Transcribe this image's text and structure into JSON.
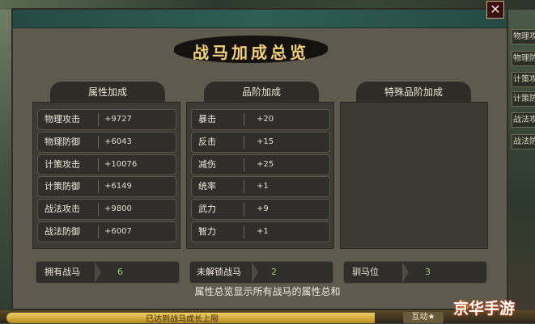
{
  "side_tabs": [
    "物理攻",
    "物理防",
    "计策攻",
    "计策防",
    "战法攻",
    "战法防"
  ],
  "panel": {
    "title": "战马加成总览",
    "close_label": "✕"
  },
  "sections": {
    "attribute": {
      "header": "属性加成",
      "rows": [
        {
          "label": "物理攻击",
          "value": "+9727"
        },
        {
          "label": "物理防御",
          "value": "+6043"
        },
        {
          "label": "计策攻击",
          "value": "+10076"
        },
        {
          "label": "计策防御",
          "value": "+6149"
        },
        {
          "label": "战法攻击",
          "value": "+9800"
        },
        {
          "label": "战法防御",
          "value": "+6007"
        }
      ]
    },
    "grade": {
      "header": "品阶加成",
      "rows": [
        {
          "label": "暴击",
          "value": "+20"
        },
        {
          "label": "反击",
          "value": "+15"
        },
        {
          "label": "减伤",
          "value": "+25"
        },
        {
          "label": "统率",
          "value": "+1"
        },
        {
          "label": "武力",
          "value": "+9"
        },
        {
          "label": "智力",
          "value": "+1"
        }
      ]
    },
    "special": {
      "header": "特殊品阶加成"
    }
  },
  "counts": [
    {
      "label": "拥有战马",
      "value": "6"
    },
    {
      "label": "未解锁战马",
      "value": "2"
    },
    {
      "label": "驯马位",
      "value": "3"
    }
  ],
  "footer_note": "属性总览显示所有战马的属性总和",
  "bottom_bar": {
    "progress_text": "已达到战马成长上限",
    "interact_label": "互动★"
  },
  "watermark": "京华手游",
  "colors": {
    "title_gold": "#f3d07a",
    "count_green": "#8fd16b",
    "panel_bg": "#5e5a4d",
    "titlebar_teal": "#2e5e56"
  }
}
